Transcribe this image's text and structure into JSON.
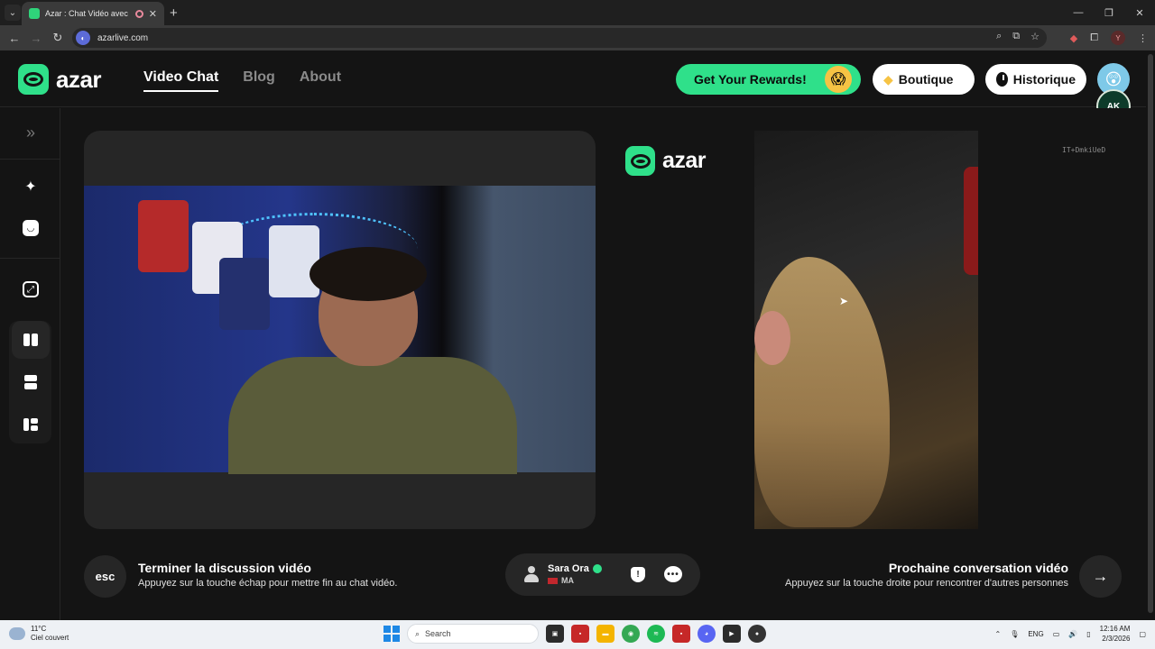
{
  "browser": {
    "tab_title": "Azar : Chat Vidéo avec de n",
    "url": "azarlive.com",
    "new_tab": "+",
    "window_controls": [
      "—",
      "❐",
      "✕"
    ]
  },
  "header": {
    "logo_text": "azar",
    "nav": [
      {
        "label": "Video Chat",
        "active": true
      },
      {
        "label": "Blog",
        "active": false
      },
      {
        "label": "About",
        "active": false
      }
    ],
    "rewards_label": "Get Your Rewards!",
    "boutique_label": "Boutique",
    "historique_label": "Historique",
    "avatar_badge": "AK"
  },
  "sidebar": {
    "icons": [
      "expand-icon",
      "magic-wand-icon",
      "face-filter-icon",
      "fullscreen-icon",
      "layout-side-by-side-icon",
      "layout-stacked-icon",
      "layout-grid-icon"
    ]
  },
  "remote": {
    "logo_text": "azar",
    "id_text": "IT+DmkiUeD"
  },
  "controls": {
    "esc_label": "esc",
    "end_title": "Terminer la discussion vidéo",
    "end_desc": "Appuyez sur la touche échap pour mettre fin au chat vidéo.",
    "user_name": "Sara Ora",
    "user_country": "MA",
    "next_title": "Prochaine conversation vidéo",
    "next_desc": "Appuyez sur la touche droite pour rencontrer d'autres personnes"
  },
  "taskbar": {
    "temperature": "11°C",
    "weather": "Ciel couvert",
    "search_placeholder": "Search",
    "lang": "ENG",
    "time": "12:16 AM",
    "date": "2/3/2026"
  },
  "colors": {
    "accent": "#2fe08a",
    "background": "#141414",
    "panel": "#262626"
  }
}
